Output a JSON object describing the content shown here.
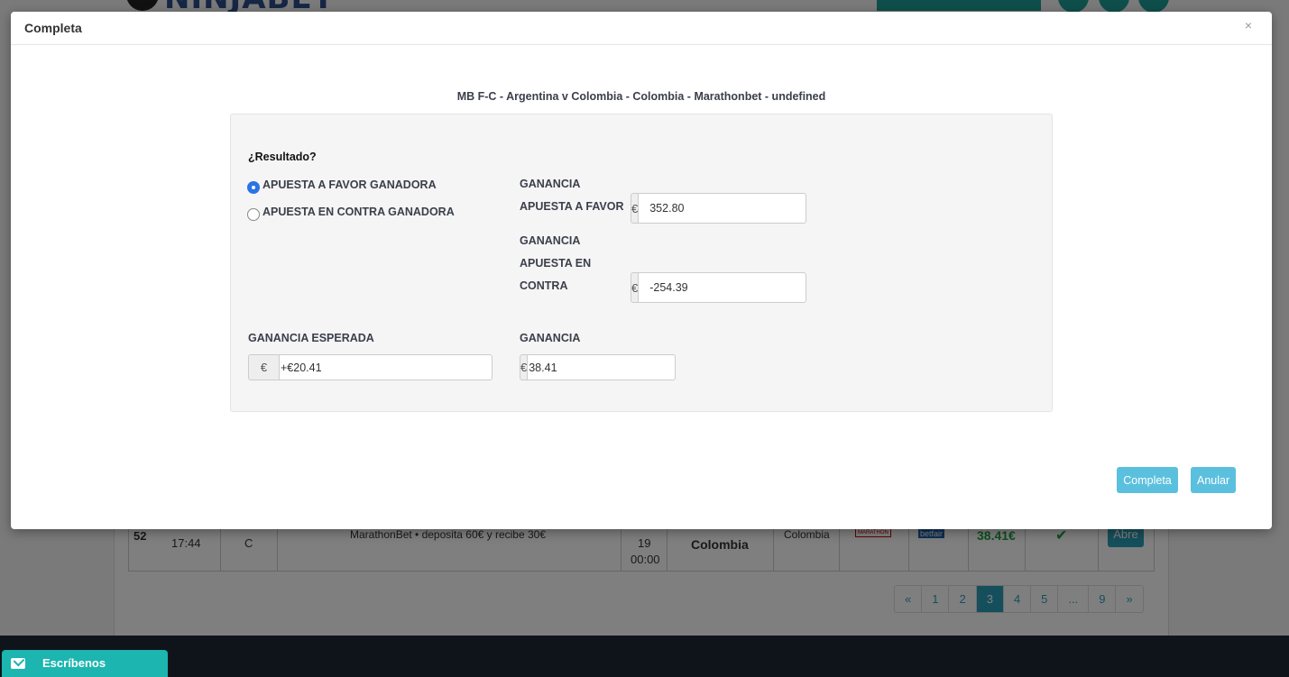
{
  "background": {
    "logo_text": "NINJABET",
    "row": {
      "id": "52",
      "time": "17:44",
      "type": "C",
      "offer": "MarathonBet • deposita 60€ y recibe 30€",
      "date_day": "19",
      "date_time": "00:00",
      "selection": "Colombia",
      "market": "Colombia",
      "bookmaker_logo": "MARATHON",
      "exchange_logo": "betfair",
      "profit": "38.41€",
      "status_icon": "check-icon",
      "action_label": "Abre"
    },
    "pagination": [
      "«",
      "1",
      "2",
      "3",
      "4",
      "5",
      "...",
      "9",
      "»"
    ],
    "pagination_active": "3"
  },
  "chat": {
    "label": "Escríbenos",
    "icon": "mail-icon"
  },
  "modal": {
    "title": "Completa",
    "close_label": "×",
    "event_title": "MB F-C - Argentina v Colombia - Colombia - Marathonbet - undefined",
    "question": "¿Resultado?",
    "options": [
      {
        "label": "APUESTA A FAVOR GANADORA",
        "checked": true
      },
      {
        "label": "APUESTA EN CONTRA GANADORA",
        "checked": false
      }
    ],
    "back_profit": {
      "label_line1": "GANANCIA",
      "label_line2": "APUESTA A FAVOR",
      "currency": "€",
      "value": "352.80"
    },
    "lay_profit": {
      "label_line1": "GANANCIA",
      "label_line2": "APUESTA EN",
      "label_line3": "CONTRA",
      "currency": "€",
      "value": "-254.39"
    },
    "expected": {
      "label": "GANANCIA ESPERADA",
      "currency": "€",
      "value": "+€20.41"
    },
    "profit": {
      "label": "GANANCIA",
      "currency": "€",
      "value": "38.41"
    },
    "buttons": {
      "complete": "Completa",
      "cancel": "Anular"
    }
  },
  "colors": {
    "accent": "#5bc0de",
    "radio": "#2a74e6",
    "chat": "#1cb5b0",
    "footer": "#1f2836"
  }
}
